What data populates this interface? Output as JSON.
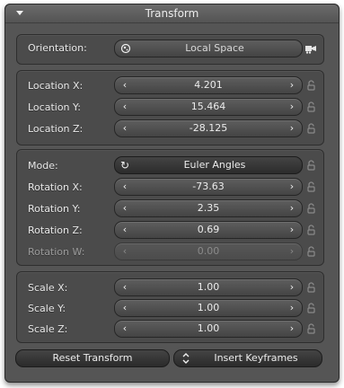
{
  "panel": {
    "title": "Transform"
  },
  "orientation": {
    "label": "Orientation:",
    "value": "Local Space",
    "icon": "globe-icon",
    "side_icon": "view-icon"
  },
  "location": {
    "x_label": "Location X:",
    "x_value": "4.201",
    "y_label": "Location Y:",
    "y_value": "15.464",
    "z_label": "Location Z:",
    "z_value": "-28.125"
  },
  "rotation": {
    "mode_label": "Mode:",
    "mode_value": "Euler Angles",
    "x_label": "Rotation X:",
    "x_value": "-73.63",
    "y_label": "Rotation Y:",
    "y_value": "2.35",
    "z_label": "Rotation Z:",
    "z_value": "0.69",
    "w_label": "Rotation W:",
    "w_value": "0.00"
  },
  "scale": {
    "x_label": "Scale X:",
    "x_value": "1.00",
    "y_label": "Scale Y:",
    "y_value": "1.00",
    "z_label": "Scale Z:",
    "z_value": "1.00"
  },
  "buttons": {
    "reset_label": "Reset Transform",
    "insert_label": "Insert Keyframes"
  }
}
